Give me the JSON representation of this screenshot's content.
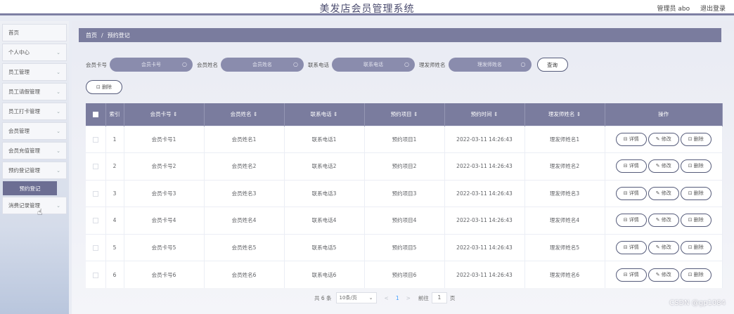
{
  "header": {
    "title": "美发店会员管理系统",
    "user": "管理员 abo",
    "logout": "退出登录"
  },
  "sidebar": {
    "items": [
      {
        "label": "首页",
        "chevron": ""
      },
      {
        "label": "个人中心",
        "chevron": "⌄"
      },
      {
        "label": "员工管理",
        "chevron": "⌄"
      },
      {
        "label": "员工请假管理",
        "chevron": "⌄"
      },
      {
        "label": "员工打卡管理",
        "chevron": "⌄"
      },
      {
        "label": "会员管理",
        "chevron": "⌄"
      },
      {
        "label": "会员充值管理",
        "chevron": "⌄"
      },
      {
        "label": "预约登记管理",
        "chevron": "⌄"
      }
    ],
    "sub_item": "预约登记",
    "last_item": {
      "label": "消费记录管理",
      "chevron": "⌄"
    }
  },
  "breadcrumb": {
    "home": "首页",
    "sep": "/",
    "current": "预约登记"
  },
  "search": {
    "card_label": "会员卡号",
    "card_placeholder": "会员卡号",
    "name_label": "会员姓名",
    "name_placeholder": "会员姓名",
    "phone_label": "联系电话",
    "phone_placeholder": "联系电话",
    "stylist_label": "理发师姓名",
    "stylist_placeholder": "理发师姓名",
    "query": "查询"
  },
  "toolbar": {
    "delete": "删除"
  },
  "table": {
    "columns": [
      "索引",
      "会员卡号 ⇕",
      "会员姓名 ⇕",
      "联系电话 ⇕",
      "预约项目 ⇕",
      "预约时间 ⇕",
      "理发师姓名 ⇕",
      "操作"
    ],
    "rows": [
      {
        "index": "1",
        "card": "会员卡号1",
        "name": "会员姓名1",
        "phone": "联系电话1",
        "item": "预约项目1",
        "time": "2022-03-11 14:26:43",
        "stylist": "理发师姓名1"
      },
      {
        "index": "2",
        "card": "会员卡号2",
        "name": "会员姓名2",
        "phone": "联系电话2",
        "item": "预约项目2",
        "time": "2022-03-11 14:26:43",
        "stylist": "理发师姓名2"
      },
      {
        "index": "3",
        "card": "会员卡号3",
        "name": "会员姓名3",
        "phone": "联系电话3",
        "item": "预约项目3",
        "time": "2022-03-11 14:26:43",
        "stylist": "理发师姓名3"
      },
      {
        "index": "4",
        "card": "会员卡号4",
        "name": "会员姓名4",
        "phone": "联系电话4",
        "item": "预约项目4",
        "time": "2022-03-11 14:26:43",
        "stylist": "理发师姓名4"
      },
      {
        "index": "5",
        "card": "会员卡号5",
        "name": "会员姓名5",
        "phone": "联系电话5",
        "item": "预约项目5",
        "time": "2022-03-11 14:26:43",
        "stylist": "理发师姓名5"
      },
      {
        "index": "6",
        "card": "会员卡号6",
        "name": "会员姓名6",
        "phone": "联系电话6",
        "item": "预约项目6",
        "time": "2022-03-11 14:26:43",
        "stylist": "理发师姓名6"
      }
    ],
    "actions": {
      "detail": "⊟ 详情",
      "edit": "✎ 修改",
      "delete": "⊡ 删除"
    }
  },
  "pagination": {
    "total": "共 6 条",
    "page_size": "10条/页",
    "prev": "<",
    "current_page": "1",
    "next": ">",
    "goto": "前往",
    "goto_value": "1",
    "page_unit": "页"
  },
  "watermark": "CSDN @gp1084",
  "colors": {
    "accent": "#7a7c9e",
    "header_border": "#7d7fa3"
  }
}
